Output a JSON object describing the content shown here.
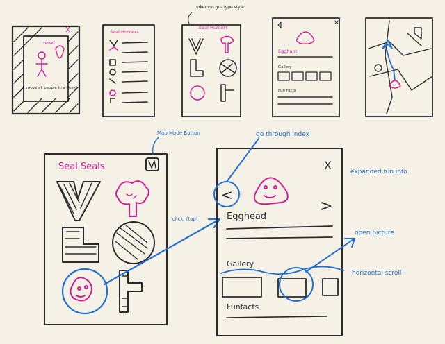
{
  "colors": {
    "ink": "#2a2a2a",
    "pink": "#d81b8f",
    "blue": "#1f6fd1",
    "paper": "#f5f1e6"
  },
  "thumbnails": {
    "t1": {
      "text_top": "new!",
      "text_bottom": "move all people in a geek!",
      "close": "X"
    },
    "t2": {
      "title": "Seal Hunters"
    },
    "t3": {
      "note": "pokemon go- type style",
      "title": "Seal Hunters"
    },
    "t4": {
      "name": "Egghunt",
      "gallery": "Gallery",
      "extra": "Fun Facts"
    },
    "t5": {}
  },
  "main_left": {
    "title": "Seal Seals",
    "map_button_note": "Map Mode Button",
    "tap_note": "'click' (tap)"
  },
  "main_right": {
    "index_note": "go through index",
    "close": "X",
    "prev": "<",
    "next": ">",
    "name": "Egghead",
    "gallery": "Gallery",
    "funfacts": "Funfacts",
    "expanded_note": "expanded fun info",
    "open_picture_note": "open picture",
    "scroll_note": "horizontal scroll"
  }
}
